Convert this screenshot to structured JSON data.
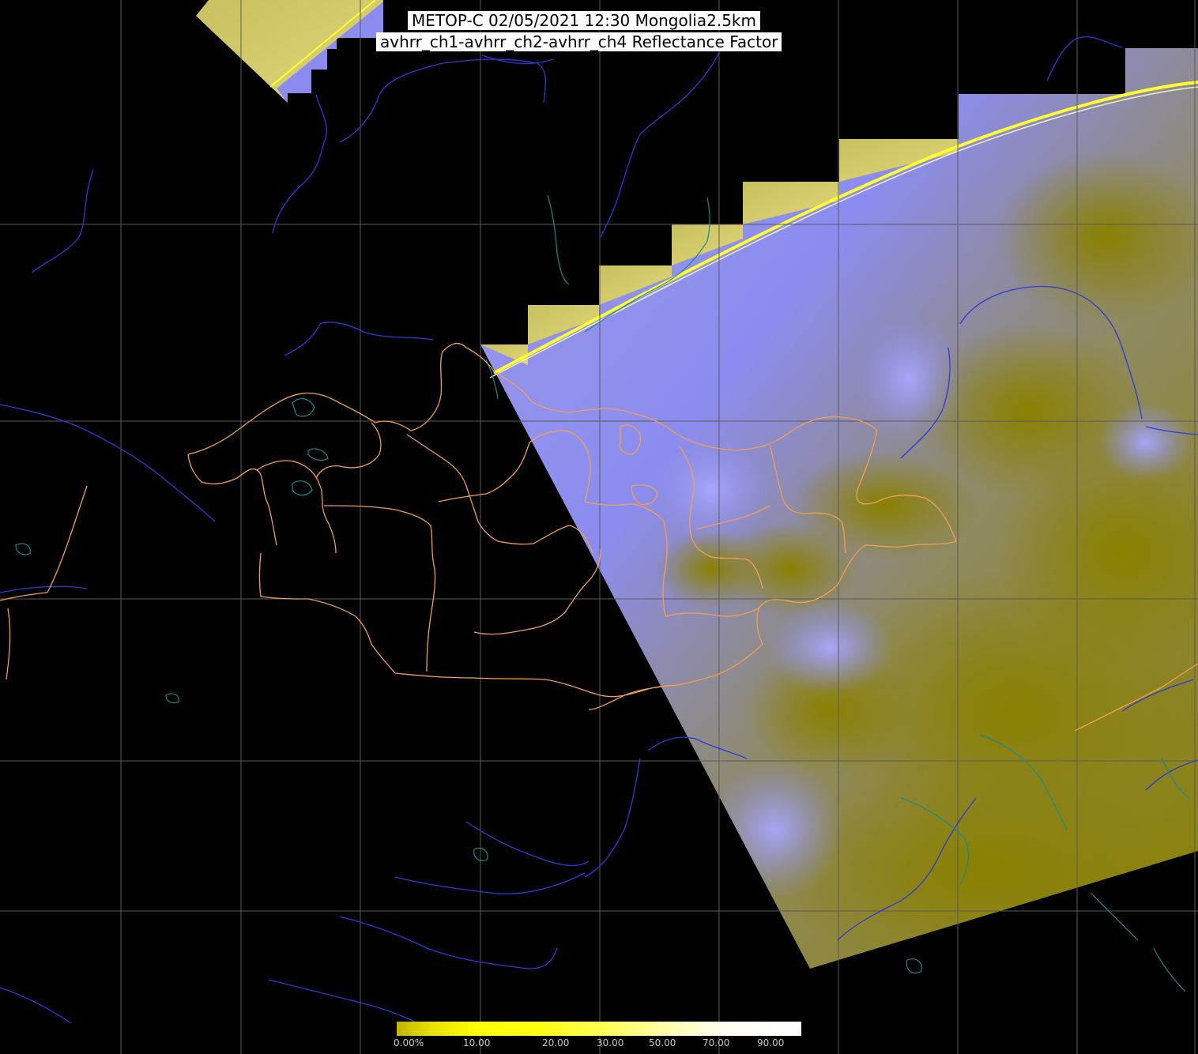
{
  "title": {
    "line1": "METOP-C 02/05/2021 12:30 Mongolia2.5km",
    "line2": "avhrr_ch1-avhrr_ch2-avhrr_ch4 Reflectance Factor"
  },
  "colorbar": {
    "labels": [
      "0.00%",
      "10.00",
      "20.00",
      "30.00",
      "50.00",
      "70.00",
      "90.00"
    ]
  },
  "colors": {
    "background": "#000000",
    "grid": "#5a5a5a",
    "rivers": "#2a3cd8",
    "lakes": "#1a8a8a",
    "admin_borders": "#f0a050",
    "cloud": "#8c8cf0",
    "ground": "#8a8000",
    "scan_edge": "#ffff30"
  }
}
